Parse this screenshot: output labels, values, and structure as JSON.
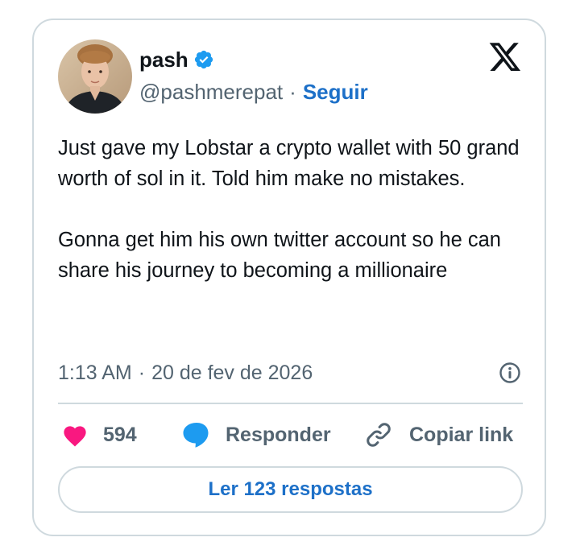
{
  "author": {
    "name": "pash",
    "handle": "@pashmerepat",
    "separator": "·",
    "follow_label": "Seguir"
  },
  "icons": {
    "verified": "verified-badge-icon",
    "brand": "x-logo-icon",
    "info": "info-icon",
    "like": "heart-icon",
    "reply": "speech-bubble-icon",
    "copy": "link-icon"
  },
  "tweet": {
    "paragraphs": [
      "Just gave my Lobstar a crypto wallet with 50 grand worth of sol in it. Told him make no mistakes.",
      "Gonna get him his own twitter account so he can share his journey to becoming a millionaire"
    ],
    "time": "1:13 AM",
    "meta_separator": "·",
    "date": "20 de fev de 2026"
  },
  "actions": {
    "likes_count": "594",
    "reply_label": "Responder",
    "copy_label": "Copiar link"
  },
  "read_replies_label": "Ler 123 respostas",
  "colors": {
    "accent": "#1d70c8",
    "like": "#f91880",
    "reply_icon": "#1d9bf0",
    "verified": "#1d9bf0",
    "border": "#cfd9de",
    "secondary_text": "#536471"
  }
}
